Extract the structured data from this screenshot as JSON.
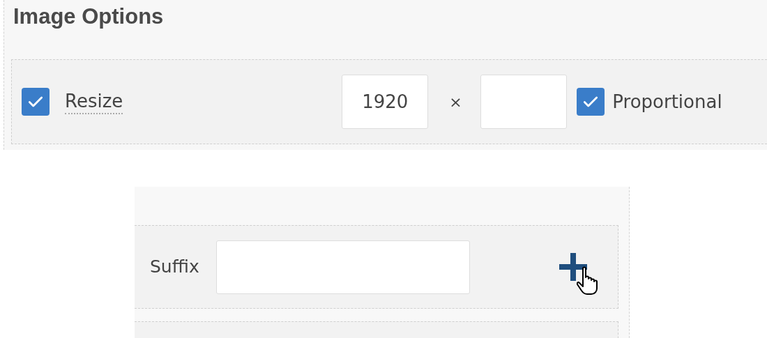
{
  "image_options": {
    "title": "Image Options",
    "resize": {
      "label": "Resize",
      "checked": true
    },
    "width": {
      "value": "1920"
    },
    "separator": "×",
    "proportional": {
      "label": "Proportional",
      "checked": true
    }
  },
  "suffix_panel": {
    "label": "Suffix"
  }
}
